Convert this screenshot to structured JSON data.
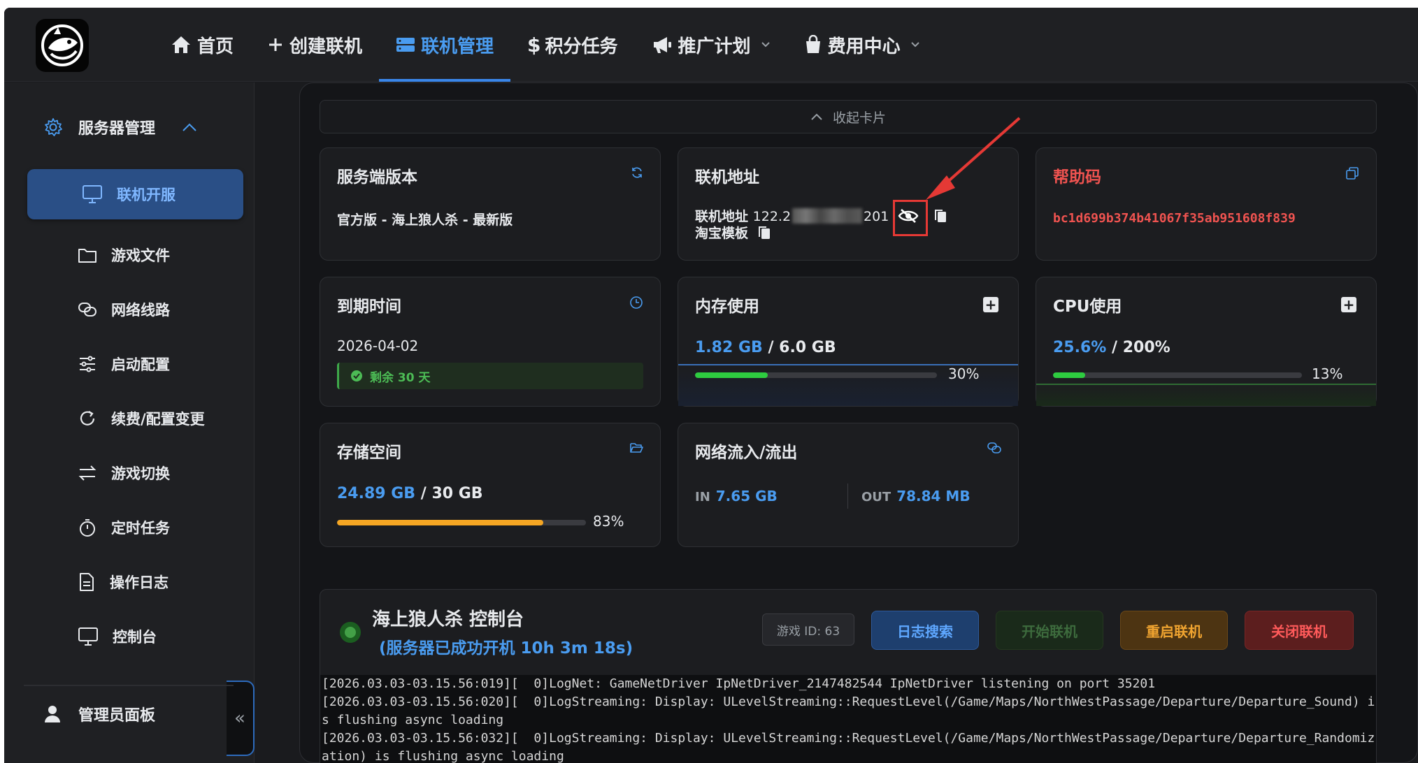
{
  "nav": {
    "home": "首页",
    "create": "创建联机",
    "manage": "联机管理",
    "tasks": "积分任务",
    "promo": "推广计划",
    "billing": "费用中心"
  },
  "sidebar": {
    "group": "服务器管理",
    "items": [
      "联机开服",
      "游戏文件",
      "网络线路",
      "启动配置",
      "续费/配置变更",
      "游戏切换",
      "定时任务",
      "操作日志",
      "控制台"
    ],
    "admin": "管理员面板"
  },
  "collapse_label": "收起卡片",
  "cards": {
    "version": {
      "title": "服务端版本",
      "value": "官方版 - 海上狼人杀 - 最新版"
    },
    "address": {
      "title": "联机地址",
      "label": "联机地址",
      "ip_start": "122.2",
      "ip_end": "201",
      "template": "淘宝模板"
    },
    "help": {
      "title": "帮助码",
      "code": "bc1d699b374b41067f35ab951608f839"
    },
    "expire": {
      "title": "到期时间",
      "date": "2026-04-02",
      "remaining": "剩余 30 天"
    },
    "memory": {
      "title": "内存使用",
      "used": "1.82 GB",
      "total": "6.0 GB",
      "percent": "30%",
      "fraction": 0.3
    },
    "cpu": {
      "title": "CPU使用",
      "used": "25.6%",
      "total": "200%",
      "percent": "13%",
      "fraction": 0.13
    },
    "storage": {
      "title": "存储空间",
      "used": "24.89 GB",
      "total": "30 GB",
      "percent": "83%",
      "fraction": 0.83
    },
    "network": {
      "title": "网络流入/流出",
      "in_label": "IN",
      "in_value": "7.65 GB",
      "out_label": "OUT",
      "out_value": "78.84 MB"
    }
  },
  "console": {
    "title": "海上狼人杀 控制台",
    "status": "(服务器已成功开机 10h 3m 18s)",
    "game_id": "游戏 ID: 63",
    "buttons": {
      "search": "日志搜索",
      "start": "开始联机",
      "restart": "重启联机",
      "stop": "关闭联机"
    },
    "log": "[2026.03.03-03.15.56:019][  0]LogNet: GameNetDriver IpNetDriver_2147482544 IpNetDriver listening on port 35201\n[2026.03.03-03.15.56:020][  0]LogStreaming: Display: ULevelStreaming::RequestLevel(/Game/Maps/NorthWestPassage/Departure/Departure_Sound) is flushing async loading\n[2026.03.03-03.15.56:032][  0]LogStreaming: Display: ULevelStreaming::RequestLevel(/Game/Maps/NorthWestPassage/Departure/Departure_Randomization) is flushing async loading"
  },
  "colors": {
    "accent": "#4a9cf0",
    "danger": "#ef5350",
    "success": "#43a047",
    "warning": "#f0a430"
  }
}
